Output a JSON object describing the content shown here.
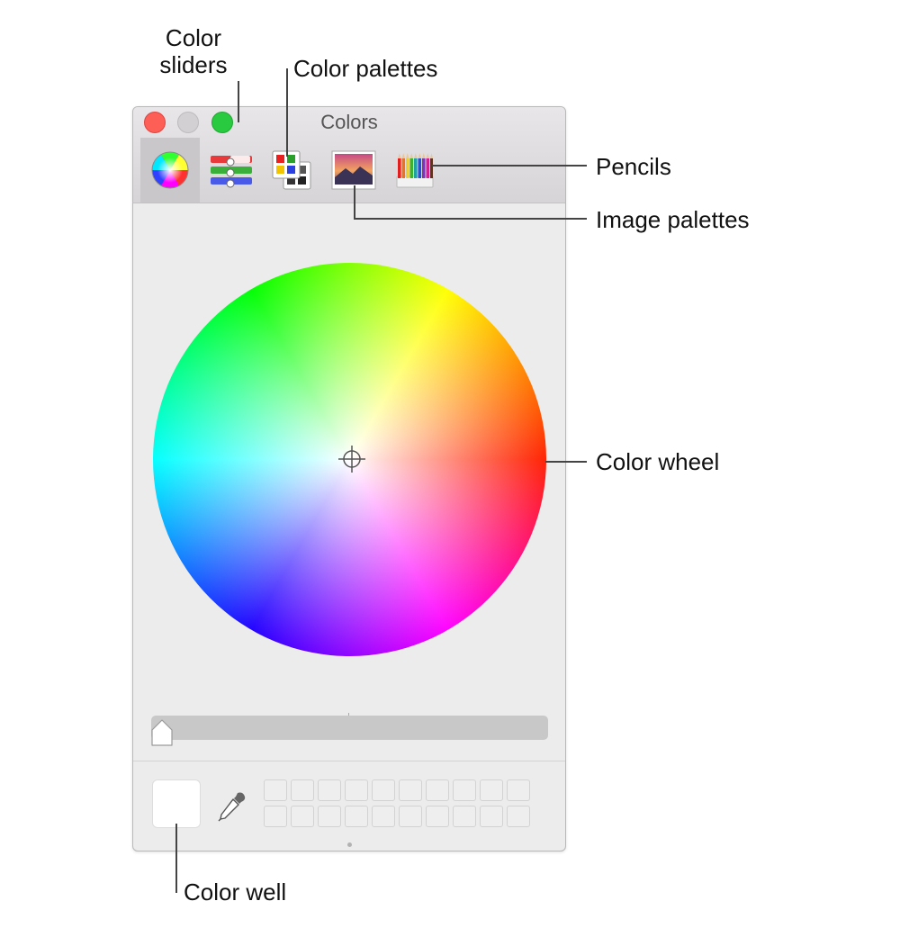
{
  "callouts": {
    "color_sliders": "Color\nsliders",
    "color_palettes": "Color palettes",
    "pencils": "Pencils",
    "image_palettes": "Image palettes",
    "color_wheel": "Color wheel",
    "color_well": "Color well"
  },
  "window": {
    "title": "Colors",
    "traffic_lights": {
      "close": "#fd5f57",
      "minimize": "#d2d0d2",
      "zoom": "#29c940"
    }
  },
  "toolbar": {
    "selected_tab": "color-wheel",
    "tabs": [
      {
        "id": "color-wheel",
        "icon": "color-wheel-icon"
      },
      {
        "id": "color-sliders",
        "icon": "color-sliders-icon"
      },
      {
        "id": "color-palettes",
        "icon": "color-palettes-icon"
      },
      {
        "id": "image-palettes",
        "icon": "image-palettes-icon"
      },
      {
        "id": "pencils",
        "icon": "pencils-icon"
      }
    ]
  },
  "brightness_slider": {
    "value": 0
  },
  "color_well": {
    "color": "#ffffff"
  },
  "swatches": {
    "rows": 2,
    "columns": 10
  }
}
